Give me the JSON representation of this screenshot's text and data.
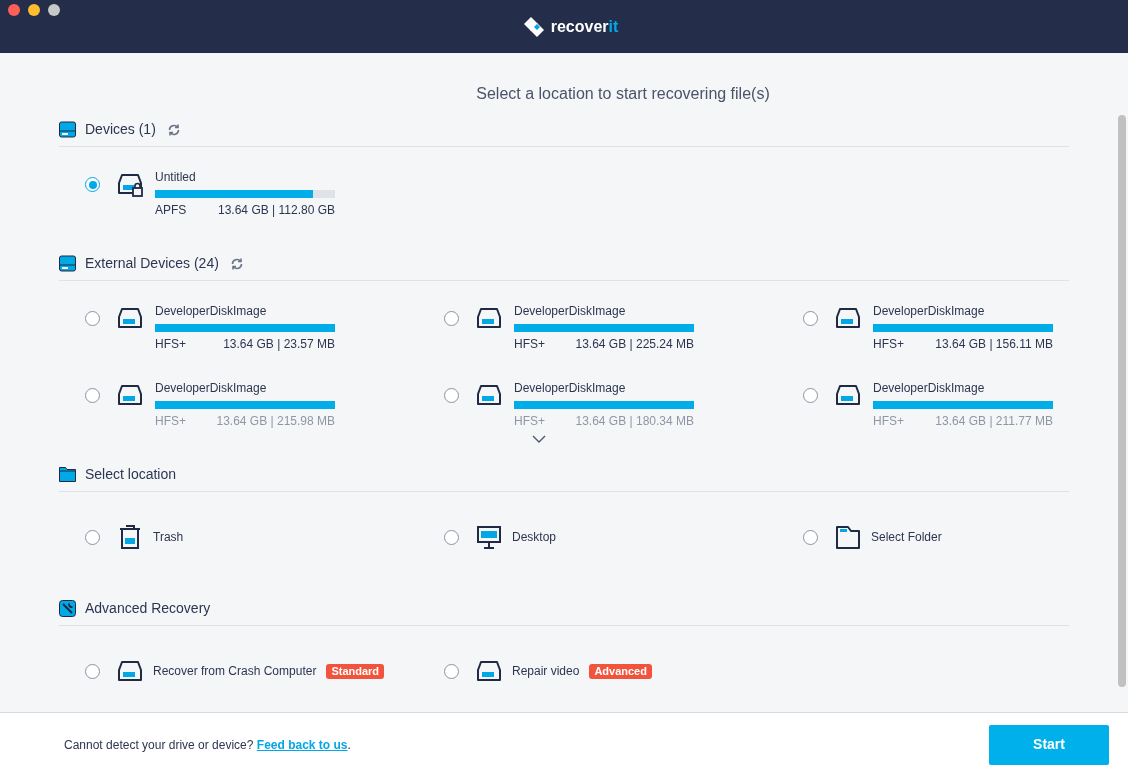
{
  "window": {
    "logo": {
      "main": "recover",
      "accent": "it"
    }
  },
  "heading": "Select a location to start recovering file(s)",
  "sections": [
    {
      "kind": "drive",
      "title": "Devices (1)",
      "refresh": true,
      "items": [
        {
          "kind": "drive-lock",
          "name": "Untitled",
          "fs": "APFS",
          "size": "13.64 GB | 112.80 GB",
          "level": 0.88,
          "selected": true,
          "faded": false
        }
      ]
    },
    {
      "kind": "drive",
      "title": "External Devices (24)",
      "refresh": true,
      "more": true,
      "items": [
        {
          "kind": "drive",
          "name": "DeveloperDiskImage",
          "fs": "HFS+",
          "size": "13.64 GB | 23.57 MB",
          "level": 1,
          "selected": false,
          "faded": false
        },
        {
          "kind": "drive",
          "name": "DeveloperDiskImage",
          "fs": "HFS+",
          "size": "13.64 GB | 225.24 MB",
          "level": 1,
          "selected": false,
          "faded": false
        },
        {
          "kind": "drive",
          "name": "DeveloperDiskImage",
          "fs": "HFS+",
          "size": "13.64 GB | 156.11 MB",
          "level": 1,
          "selected": false,
          "faded": false
        },
        {
          "kind": "drive",
          "name": "DeveloperDiskImage",
          "fs": "HFS+",
          "size": "13.64 GB | 215.98 MB",
          "level": 1,
          "selected": false,
          "faded": true
        },
        {
          "kind": "drive",
          "name": "DeveloperDiskImage",
          "fs": "HFS+",
          "size": "13.64 GB | 180.34 MB",
          "level": 1,
          "selected": false,
          "faded": true
        },
        {
          "kind": "drive",
          "name": "DeveloperDiskImage",
          "fs": "HFS+",
          "size": "13.64 GB | 211.77 MB",
          "level": 1,
          "selected": false,
          "faded": true
        }
      ]
    },
    {
      "kind": "folder",
      "title": "Select location",
      "refresh": false,
      "items": [
        {
          "kind": "trash",
          "name": "Trash",
          "selected": false
        },
        {
          "kind": "desktop",
          "name": "Desktop",
          "selected": false
        },
        {
          "kind": "folder",
          "name": "Select Folder",
          "selected": false
        }
      ]
    },
    {
      "kind": "wrench",
      "title": "Advanced Recovery",
      "refresh": false,
      "items": [
        {
          "kind": "drive",
          "name": "Recover from Crash Computer",
          "badge": "Standard",
          "selected": false
        },
        {
          "kind": "drive",
          "name": "Repair video",
          "badge": "Advanced",
          "selected": false
        }
      ]
    }
  ],
  "footer": {
    "text": "Cannot detect your drive or device?",
    "link": "Feed back to us",
    "after": ".",
    "button": "Start"
  }
}
